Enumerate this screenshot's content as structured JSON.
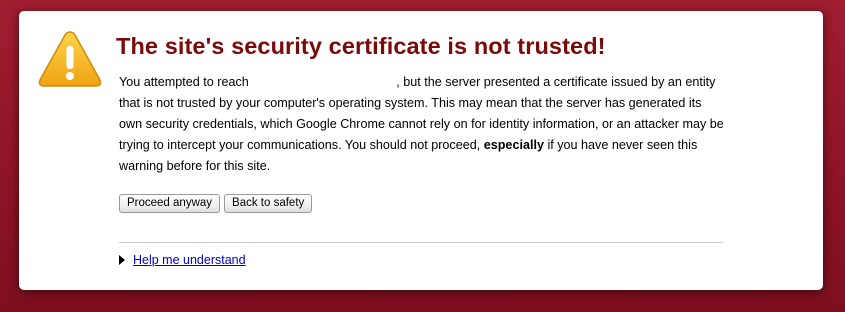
{
  "interstitial": {
    "icon": "warning-triangle-icon",
    "title": "The site's security certificate is not trusted!",
    "body": {
      "intro": "You attempted to reach",
      "after_host": ", but the server presented a certificate issued by an entity that is not trusted by your computer's operating system. This may mean that the server has generated its own security credentials, which Google Chrome cannot rely on for identity information, or an attacker may be trying to intercept your communications. You should not proceed,",
      "emphasis": "especially",
      "ending": " if you have never seen this warning before for this site."
    },
    "buttons": {
      "proceed_label": "Proceed anyway",
      "back_label": "Back to safety"
    },
    "help_link": "Help me understand"
  },
  "colors": {
    "background": "#8e1426",
    "title": "#7a0a0a",
    "link": "#0000cc",
    "icon_fill": "#f2b21b"
  }
}
